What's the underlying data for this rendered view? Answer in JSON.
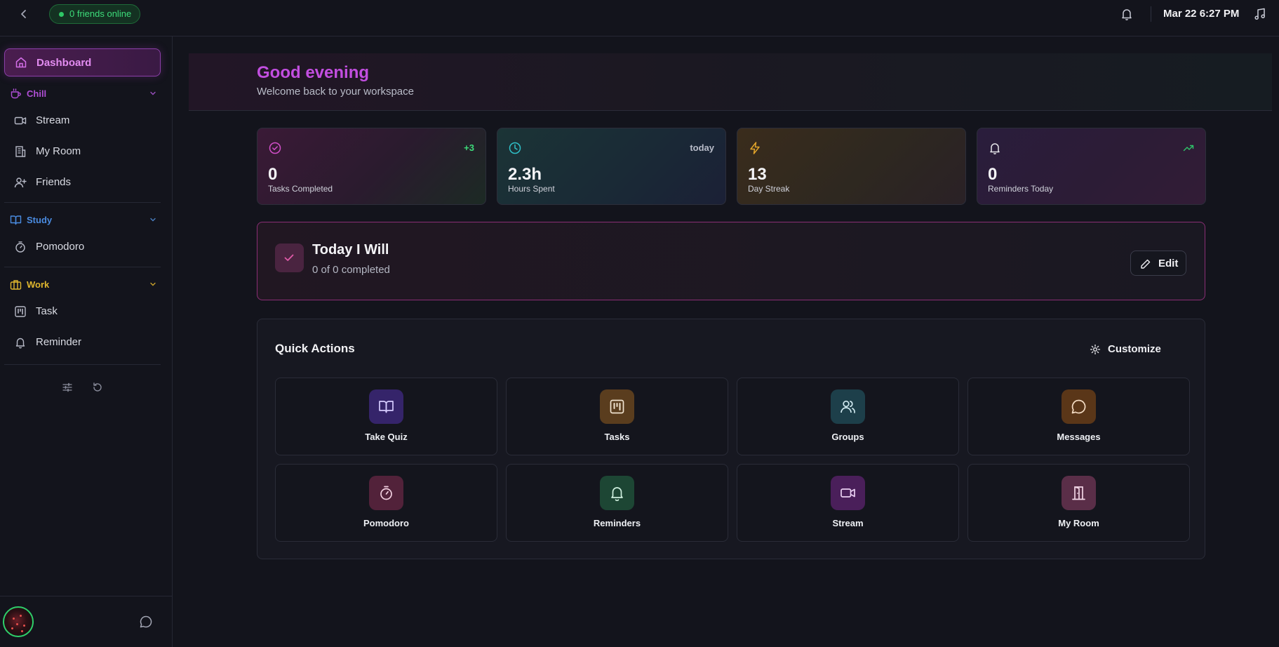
{
  "topbar": {
    "friends_online": "0 friends online",
    "datetime": "Mar 22 6:27 PM"
  },
  "sidebar": {
    "active_item": "Dashboard",
    "sections": {
      "chill": {
        "label": "Chill",
        "color": "#b04fd6",
        "items": [
          "Stream",
          "My Room",
          "Friends"
        ]
      },
      "study": {
        "label": "Study",
        "color": "#4a8be0",
        "items": [
          "Pomodoro"
        ]
      },
      "work": {
        "label": "Work",
        "color": "#e0b72e",
        "items": [
          "Task",
          "Reminder"
        ]
      }
    }
  },
  "greeting": {
    "title": "Good evening",
    "subtitle": "Welcome back to your workspace"
  },
  "stats": [
    {
      "value": "0",
      "caption": "Tasks Completed",
      "badge": "+3",
      "icon": "check-circle-icon",
      "accent": "#d24fc9"
    },
    {
      "value": "2.3h",
      "caption": "Hours Spent",
      "badge": "today",
      "icon": "clock-icon",
      "accent": "#2fc0c8"
    },
    {
      "value": "13",
      "caption": "Day Streak",
      "badge": "",
      "icon": "lightning-icon",
      "accent": "#e0a32a"
    },
    {
      "value": "0",
      "caption": "Reminders Today",
      "badge": "",
      "icon": "bell-icon",
      "accent": "#e6e6ea"
    }
  ],
  "today": {
    "title": "Today I Will",
    "subtitle": "0 of 0 completed",
    "edit_label": "Edit"
  },
  "quick_actions": {
    "title": "Quick Actions",
    "customize_label": "Customize",
    "tiles": [
      {
        "label": "Take Quiz",
        "icon": "book-open-icon",
        "bg": "#35246a",
        "fg": "#d6ccff"
      },
      {
        "label": "Tasks",
        "icon": "kanban-icon",
        "bg": "#5a3d1e",
        "fg": "#f0e2cf"
      },
      {
        "label": "Groups",
        "icon": "users-icon",
        "bg": "#1d3f4a",
        "fg": "#cfe8ef"
      },
      {
        "label": "Messages",
        "icon": "chat-icon",
        "bg": "#5a3618",
        "fg": "#f4dcc4"
      },
      {
        "label": "Pomodoro",
        "icon": "timer-icon",
        "bg": "#52223a",
        "fg": "#f2d0e0"
      },
      {
        "label": "Reminders",
        "icon": "bell-icon",
        "bg": "#1d4634",
        "fg": "#cdeedd"
      },
      {
        "label": "Stream",
        "icon": "video-icon",
        "bg": "#4a1f5a",
        "fg": "#ead0f2"
      },
      {
        "label": "My Room",
        "icon": "door-icon",
        "bg": "#5a2e48",
        "fg": "#f2d6e6"
      }
    ]
  }
}
